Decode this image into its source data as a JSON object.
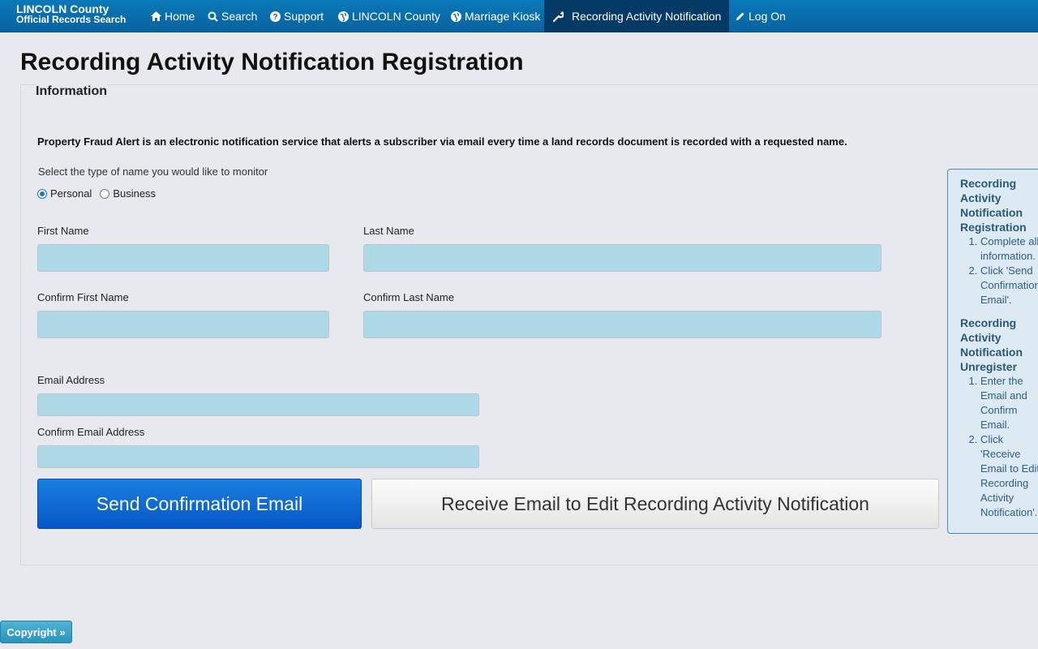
{
  "brand": {
    "line1": "LINCOLN County",
    "line2": "Official Records Search"
  },
  "nav": {
    "home": "Home",
    "search": "Search",
    "support": "Support",
    "county": "LINCOLN County",
    "kiosk": "Marriage Kiosk",
    "notification": "Recording Activity Notification",
    "logon": "Log On"
  },
  "page": {
    "title": "Recording Activity Notification Registration"
  },
  "info": {
    "legend": "Information",
    "intro": "Property Fraud Alert is an electronic notification service that alerts a subscriber via email every time a land records document is recorded with a requested name.",
    "select_label": "Select the type of name you would like to monitor",
    "radio_personal": "Personal",
    "radio_business": "Business",
    "selected": "Personal"
  },
  "form": {
    "first_name": "First Name",
    "last_name": "Last Name",
    "confirm_first_name": "Confirm First Name",
    "confirm_last_name": "Confirm Last Name",
    "email": "Email Address",
    "confirm_email": "Confirm Email Address"
  },
  "buttons": {
    "send": "Send Confirmation Email",
    "receive": "Receive Email to Edit Recording Activity Notification"
  },
  "help": {
    "register_title": "Recording Activity Notification Registration",
    "register_steps": [
      "Complete all information.",
      "Click 'Send Confirmation Email'."
    ],
    "unregister_title": "Recording Activity Notification Unregister",
    "unregister_steps": [
      "Enter the Email and Confirm Email.",
      "Click 'Receive Email to Edit Recording Activity Notification'."
    ]
  },
  "footer": {
    "copyright": "Copyright »"
  },
  "colors": {
    "navbar": "#0a6fae",
    "primary": "#0a6bd3",
    "input_bg": "#add8e6"
  }
}
